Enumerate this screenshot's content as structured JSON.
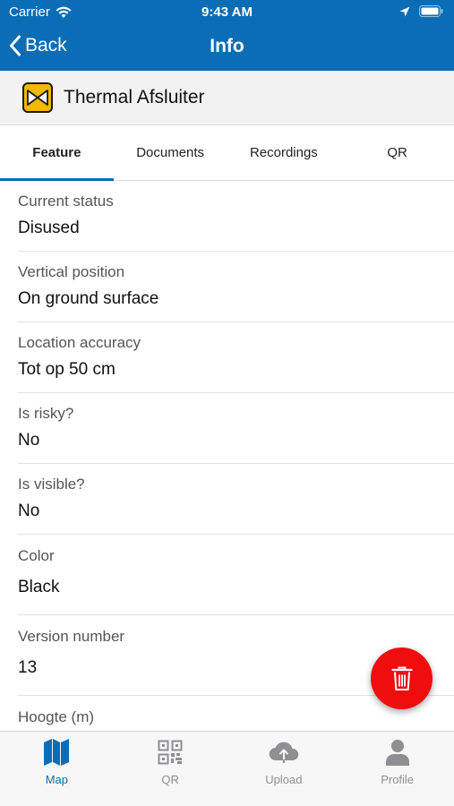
{
  "status_bar": {
    "carrier": "Carrier",
    "time": "9:43 AM"
  },
  "nav": {
    "back_label": "Back",
    "title": "Info"
  },
  "feature": {
    "name": "Thermal Afsluiter",
    "icon": "valve-icon"
  },
  "tabs": [
    {
      "label": "Feature",
      "active": true
    },
    {
      "label": "Documents",
      "active": false
    },
    {
      "label": "Recordings",
      "active": false
    },
    {
      "label": "QR",
      "active": false
    }
  ],
  "fields": [
    {
      "label": "Current status",
      "value": "Disused"
    },
    {
      "label": "Vertical position",
      "value": "On ground surface"
    },
    {
      "label": "Location accuracy",
      "value": "Tot op 50 cm"
    },
    {
      "label": "Is risky?",
      "value": "No"
    },
    {
      "label": "Is visible?",
      "value": "No"
    },
    {
      "label": "Color",
      "value": "Black"
    },
    {
      "label": "Version number",
      "value": "13"
    },
    {
      "label": "Hoogte (m)",
      "value": ""
    }
  ],
  "bottom_tabs": [
    {
      "label": "Map",
      "icon": "map-icon",
      "active": true
    },
    {
      "label": "QR",
      "icon": "qr-icon",
      "active": false
    },
    {
      "label": "Upload",
      "icon": "upload-cloud-icon",
      "active": false
    },
    {
      "label": "Profile",
      "icon": "profile-icon",
      "active": false
    }
  ],
  "colors": {
    "primary": "#0a6db5",
    "delete": "#f00d0d",
    "inactive": "#8e8e93"
  }
}
